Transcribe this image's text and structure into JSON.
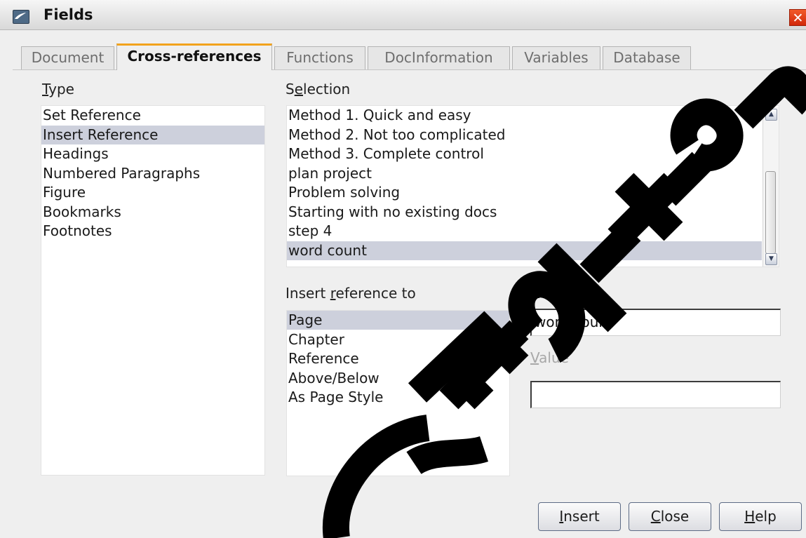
{
  "window": {
    "title": "Fields",
    "close_glyph": "✕"
  },
  "tabs": [
    {
      "label": "Document",
      "active": false
    },
    {
      "label": "Cross-references",
      "active": true
    },
    {
      "label": "Functions",
      "active": false
    },
    {
      "label": "DocInformation",
      "active": false
    },
    {
      "label": "Variables",
      "active": false
    },
    {
      "label": "Database",
      "active": false
    }
  ],
  "type": {
    "label_mnemonic": "T",
    "label_rest": "ype",
    "items": [
      "Set Reference",
      "Insert Reference",
      "Headings",
      "Numbered Paragraphs",
      "Figure",
      "Bookmarks",
      "Footnotes"
    ],
    "selected": "Insert Reference"
  },
  "selection": {
    "label_pre": "S",
    "label_mnemonic": "e",
    "label_rest": "lection",
    "items": [
      "Method 1. Quick and easy",
      "Method 2. Not too complicated",
      "Method 3. Complete control",
      "plan project",
      "Problem solving",
      "Starting with no existing docs",
      "step 4",
      "word count"
    ],
    "selected": "word count"
  },
  "insert_reference_to": {
    "label_pre": "Insert ",
    "label_mnemonic": "r",
    "label_rest": "eference to",
    "items": [
      "Page",
      "Chapter",
      "Reference",
      "Above/Below",
      "As Page Style"
    ],
    "selected": "Page"
  },
  "name_field": {
    "label_pre": "Na",
    "label_mnemonic": "m",
    "label_rest": "e",
    "value": "word count"
  },
  "value_field": {
    "label_mnemonic": "V",
    "label_rest": "alue",
    "value": ""
  },
  "buttons": {
    "insert": {
      "mnemonic": "I",
      "rest": "nsert"
    },
    "close": {
      "mnemonic": "C",
      "rest": "lose"
    },
    "help": {
      "mnemonic": "H",
      "rest": "elp"
    }
  },
  "watermark": "Book Edition",
  "colors": {
    "selection_highlight": "#cdd0dc",
    "active_tab_accent": "#f2a31d",
    "close_button": "#d9300e"
  },
  "icons": {
    "app": "openoffice-gull-icon",
    "scroll_up": "arrow-up-icon",
    "scroll_down": "arrow-down-icon"
  }
}
